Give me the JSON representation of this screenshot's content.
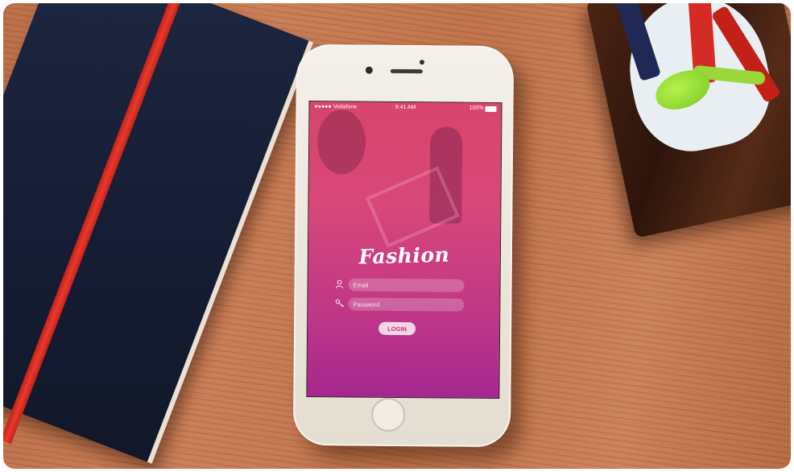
{
  "status_bar": {
    "carrier": "●●●●● Vodafone",
    "time": "9:41 AM",
    "battery": "100%"
  },
  "app": {
    "logo_text": "Fashion"
  },
  "login_form": {
    "email_placeholder": "Email",
    "password_placeholder": "Password",
    "login_label": "LOGIN"
  },
  "icons": {
    "email": "user-icon",
    "password": "key-icon"
  },
  "colors": {
    "brand_gradient_top": "#d63660",
    "brand_gradient_bottom": "#a01e8c",
    "button_bg": "#f3d6e4",
    "button_text": "#c0357c"
  }
}
